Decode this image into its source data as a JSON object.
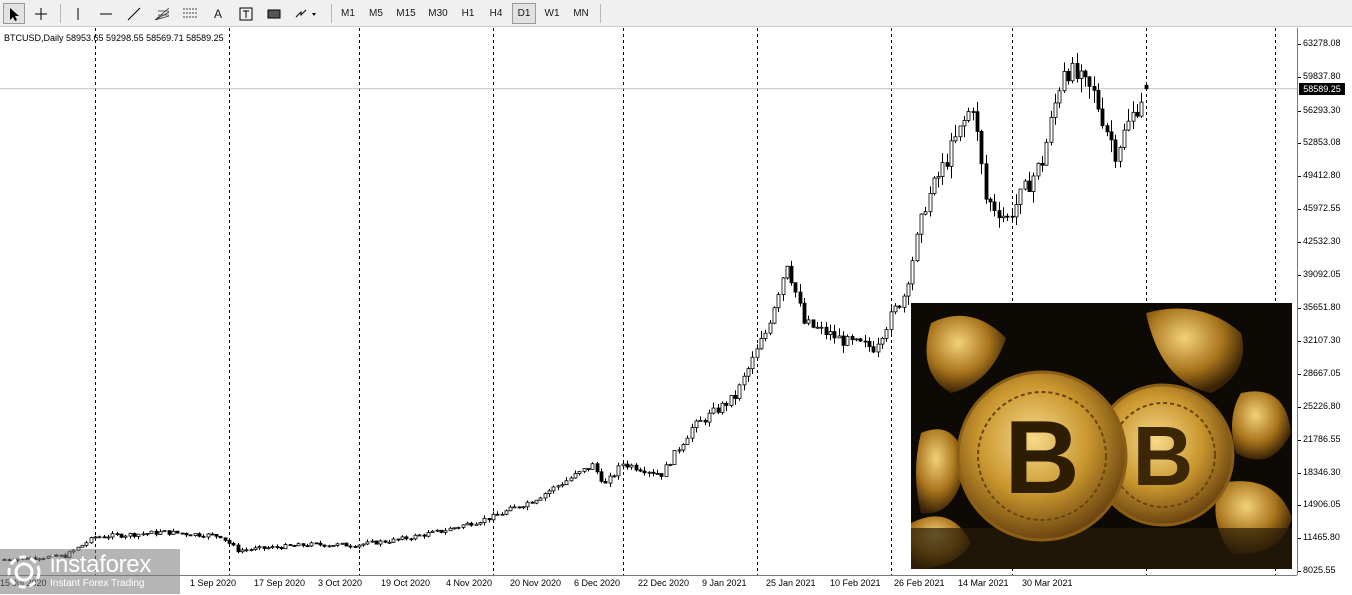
{
  "toolbar": {
    "tools": [
      "cursor-arrow-icon",
      "crosshair-icon",
      "vertical-line-icon",
      "horizontal-line-icon",
      "trendline-icon",
      "fibonacci-fan-icon",
      "fibonacci-retracement-icon",
      "text-icon",
      "text-label-icon",
      "rectangle-icon",
      "arrows-icon"
    ],
    "text_tool_label": "A",
    "timeframes": [
      "M1",
      "M5",
      "M15",
      "M30",
      "H1",
      "H4",
      "D1",
      "W1",
      "MN"
    ],
    "active_timeframe": "D1"
  },
  "symbol_info": "BTCUSD,Daily  58953.65 59298.55 58569.71 58589.25",
  "current_price_label": "58589.25",
  "logo": {
    "title": "instaforex",
    "subtitle": "Instant Forex Trading"
  },
  "chart_data": {
    "type": "candlestick",
    "symbol": "BTCUSD",
    "period": "Daily",
    "last_bar": {
      "open": 58953.65,
      "high": 59298.55,
      "low": 58569.71,
      "close": 58589.25
    },
    "current_price": 58589.25,
    "ylim": [
      8025.55,
      63278.08
    ],
    "y_ticks": [
      "63278.08",
      "59837.80",
      "56293.30",
      "52853.08",
      "49412.80",
      "45972.55",
      "42532.30",
      "39092.05",
      "35651.80",
      "32107.30",
      "28667.05",
      "25226.80",
      "21786.55",
      "18346.30",
      "14906.05",
      "11465.80",
      "8025.55"
    ],
    "x_ticks": [
      "15 Jul 2020",
      "1 Sep 2020",
      "17 Sep 2020",
      "3 Oct 2020",
      "19 Oct 2020",
      "4 Nov 2020",
      "20 Nov 2020",
      "6 Dec 2020",
      "22 Dec 2020",
      "9 Jan 2021",
      "25 Jan 2021",
      "10 Feb 2021",
      "26 Feb 2021",
      "14 Mar 2021",
      "30 Mar 2021"
    ],
    "x_range": [
      "2020-07-10",
      "2021-05-06"
    ],
    "period_separators": [
      "2020-08-01",
      "2020-09-01",
      "2020-10-01",
      "2020-11-01",
      "2020-12-01",
      "2021-01-01",
      "2021-02-01",
      "2021-03-01",
      "2021-04-01",
      "2021-05-01"
    ],
    "close_path": [
      [
        "2020-07-10",
        9200
      ],
      [
        "2020-07-25",
        9600
      ],
      [
        "2020-08-01",
        11600
      ],
      [
        "2020-08-17",
        12100
      ],
      [
        "2020-08-30",
        11700
      ],
      [
        "2020-09-03",
        10200
      ],
      [
        "2020-09-20",
        10800
      ],
      [
        "2020-09-30",
        10750
      ],
      [
        "2020-10-10",
        11300
      ],
      [
        "2020-10-20",
        12200
      ],
      [
        "2020-11-01",
        13700
      ],
      [
        "2020-11-10",
        15400
      ],
      [
        "2020-11-24",
        19100
      ],
      [
        "2020-11-27",
        17100
      ],
      [
        "2020-12-01",
        19300
      ],
      [
        "2020-12-10",
        18200
      ],
      [
        "2020-12-17",
        23000
      ],
      [
        "2020-12-27",
        26300
      ],
      [
        "2021-01-03",
        33000
      ],
      [
        "2021-01-08",
        40500
      ],
      [
        "2021-01-12",
        34000
      ],
      [
        "2021-01-22",
        32000
      ],
      [
        "2021-01-28",
        31500
      ],
      [
        "2021-02-04",
        37000
      ],
      [
        "2021-02-09",
        46500
      ],
      [
        "2021-02-20",
        57000
      ],
      [
        "2021-02-23",
        47000
      ],
      [
        "2021-02-28",
        45000
      ],
      [
        "2021-03-08",
        51000
      ],
      [
        "2021-03-13",
        61000
      ],
      [
        "2021-03-20",
        58000
      ],
      [
        "2021-03-25",
        52000
      ],
      [
        "2021-04-01",
        58700
      ]
    ]
  }
}
